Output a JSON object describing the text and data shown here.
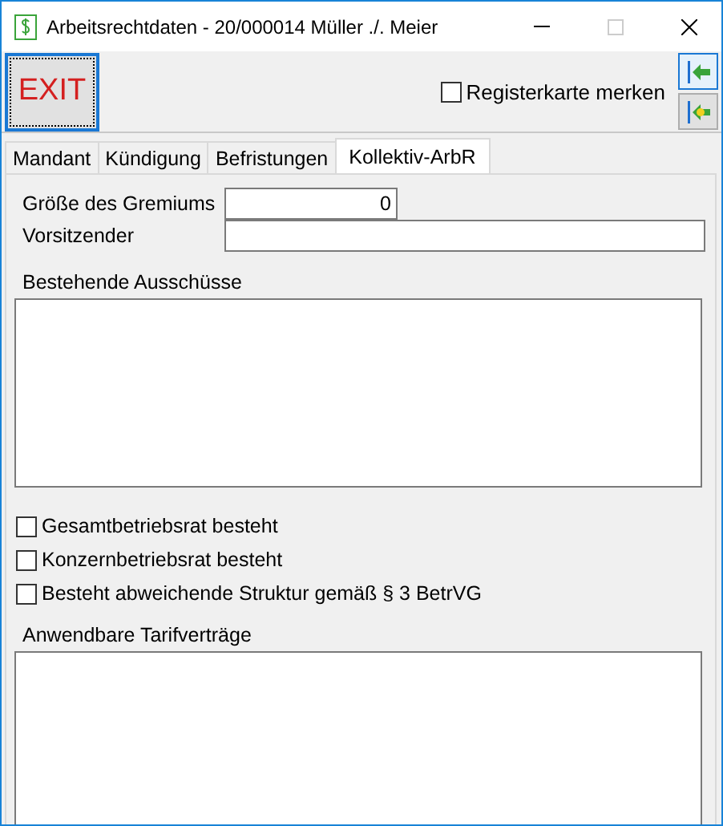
{
  "window": {
    "title": "Arbeitsrechtdaten - 20/000014  Müller ./. Meier"
  },
  "toolbar": {
    "exit_button": "EXIT",
    "remember_tab": {
      "label": "Registerkarte merken",
      "checked": false
    }
  },
  "tabs": [
    {
      "label": "Mandant",
      "selected": false
    },
    {
      "label": "Kündigung",
      "selected": false
    },
    {
      "label": "Befristungen",
      "selected": false
    },
    {
      "label": "Kollektiv-ArbR",
      "selected": true
    }
  ],
  "committee_size": {
    "label": "Größe des Gremiums",
    "value": "0"
  },
  "chairman": {
    "label": "Vorsitzender"
  },
  "committees": {
    "label": "Bestehende Ausschüsse"
  },
  "options": [
    {
      "label": "Gesamtbetriebsrat besteht",
      "checked": false
    },
    {
      "label": "Konzernbetriebsrat besteht",
      "checked": false
    },
    {
      "label": "Besteht abweichende Struktur gemäß § 3 BetrVG",
      "checked": false
    }
  ],
  "tariffs": {
    "label": "Anwendbare Tarifverträge"
  }
}
